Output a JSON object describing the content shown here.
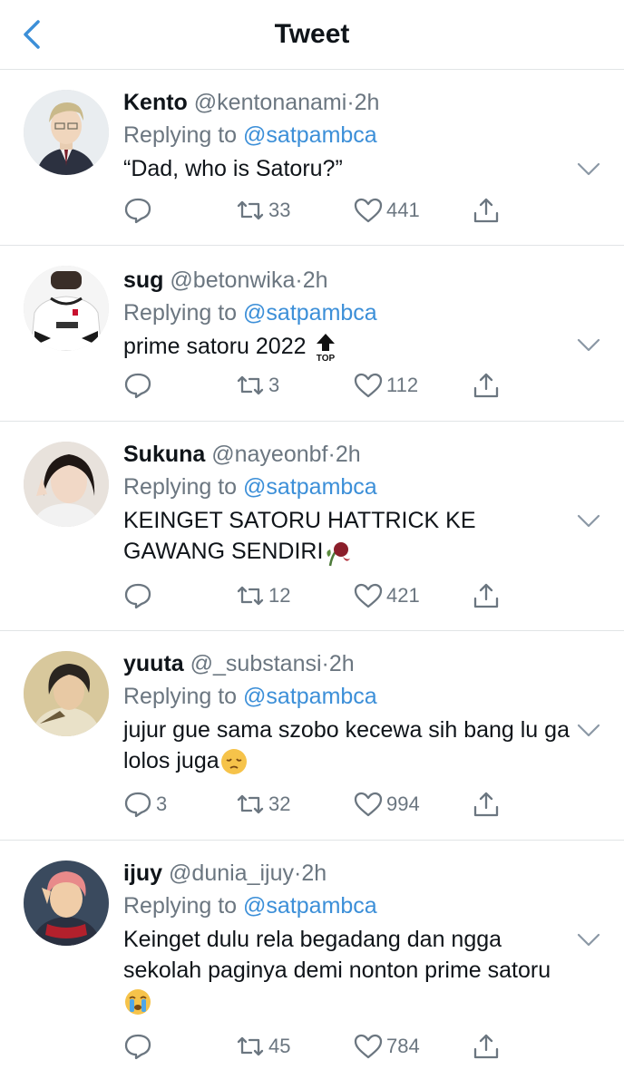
{
  "header": {
    "title": "Tweet"
  },
  "reply_prefix": "Replying to",
  "tweets": [
    {
      "name": "Kento",
      "handle": "@kentonanami",
      "separator": "·",
      "time": "2h",
      "mention": "@satpambca",
      "text": "“Dad, who is Satoru?”",
      "replies": "",
      "retweets": "33",
      "likes": "441"
    },
    {
      "name": "sug",
      "handle": "@betonwika",
      "separator": "·",
      "time": "2h",
      "mention": "@satpambca",
      "text": "prime satoru 2022",
      "emoji": "top-arrow",
      "replies": "",
      "retweets": "3",
      "likes": "112"
    },
    {
      "name": "Sukuna",
      "handle": "@nayeonbf",
      "separator": "·",
      "time": "2h",
      "mention": "@satpambca",
      "text": "KEINGET SATORU HATTRICK KE GAWANG SENDIRI",
      "emoji": "wilted-rose",
      "replies": "",
      "retweets": "12",
      "likes": "421"
    },
    {
      "name": "yuuta",
      "handle": "@_substansi",
      "separator": "·",
      "time": "2h",
      "mention": "@satpambca",
      "text": "jujur gue sama szobo kecewa sih bang lu ga lolos juga",
      "emoji": "pensive-face",
      "replies": "3",
      "retweets": "32",
      "likes": "994"
    },
    {
      "name": "ijuy",
      "handle": "@dunia_ijuy",
      "separator": "·",
      "time": "2h",
      "mention": "@satpambca",
      "text": "Keinget dulu rela begadang dan ngga sekolah paginya demi nonton prime satoru",
      "emoji": "crying-face",
      "replies": "",
      "retweets": "45",
      "likes": "784"
    }
  ]
}
